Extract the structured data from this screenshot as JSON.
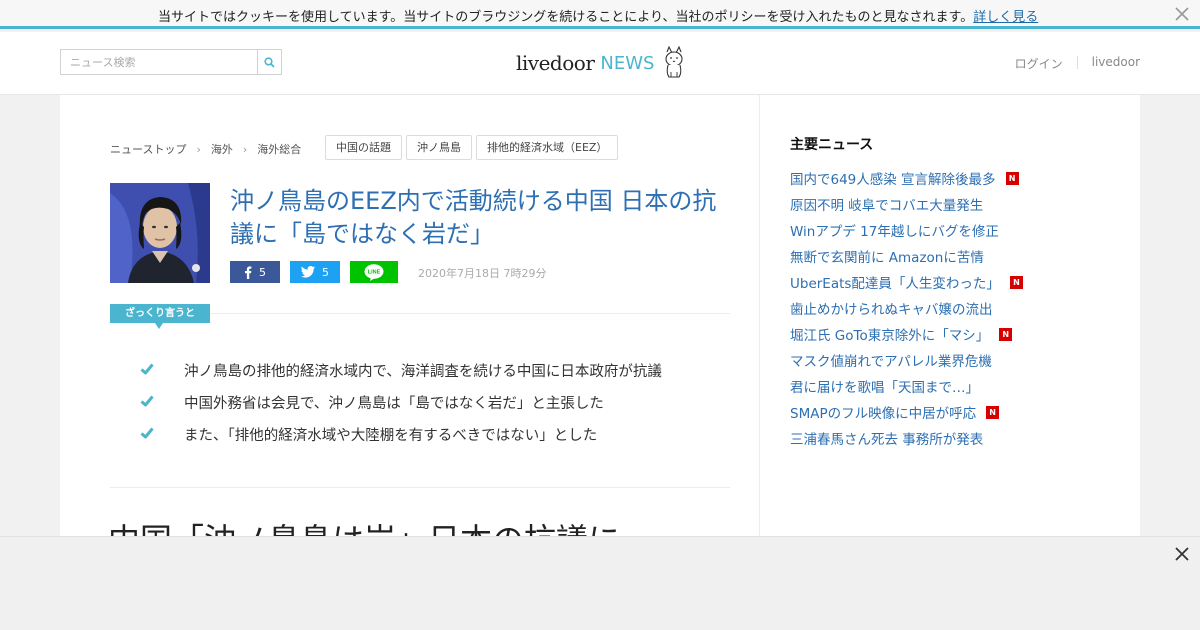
{
  "cookie_bar": {
    "text": "当サイトではクッキーを使用しています。当サイトのブラウジングを続けることにより、当社のポリシーを受け入れたものと見なされます。",
    "link": "詳しく見る",
    "close_icon": "close-icon"
  },
  "header": {
    "search_placeholder": "ニュース検索",
    "search_icon": "search-icon",
    "logo_livedoor": "livedoor",
    "logo_news": "NEWS",
    "logo_mark": "dog-mascot-icon",
    "login_link": "ログイン",
    "livedoor_link": "livedoor"
  },
  "breadcrumb": [
    "ニューストップ",
    "海外",
    "海外総合"
  ],
  "tags": [
    "中国の話題",
    "沖ノ鳥島",
    "排他的経済水域（EEZ）"
  ],
  "article": {
    "headline": "沖ノ鳥島のEEZ内で活動続ける中国 日本の抗議に「島ではなく岩だ」",
    "facebook_count": "5",
    "twitter_count": "5",
    "line_label": "LINE",
    "date": "2020年7月18日 7時29分",
    "summary_badge": "ざっくり言うと",
    "summary": [
      "沖ノ鳥島の排他的経済水域内で、海洋調査を続ける中国に日本政府が抗議",
      "中国外務省は会見で、沖ノ鳥島は「島ではなく岩だ」と主張した",
      "また、「排他的経済水域や大陸棚を有するべきではない」とした"
    ],
    "body_title": "中国「沖ノ鳥島は岩」日本の抗議に"
  },
  "sidebar": {
    "title": "主要ニュース",
    "new_badge": "N",
    "items": [
      {
        "label": "国内で649人感染 宣言解除後最多",
        "is_new": true
      },
      {
        "label": "原因不明 岐阜でコバエ大量発生",
        "is_new": false
      },
      {
        "label": "Winアプデ 17年越しにバグを修正",
        "is_new": false
      },
      {
        "label": "無断で玄関前に Amazonに苦情",
        "is_new": false
      },
      {
        "label": "UberEats配達員「人生変わった」",
        "is_new": true
      },
      {
        "label": "歯止めかけられぬキャバ嬢の流出",
        "is_new": false
      },
      {
        "label": "堀江氏 GoTo東京除外に「マシ」",
        "is_new": true
      },
      {
        "label": "マスク値崩れでアパレル業界危機",
        "is_new": false
      },
      {
        "label": "君に届けを歌唱「天国まで…」",
        "is_new": false
      },
      {
        "label": "SMAPのフル映像に中居が呼応",
        "is_new": true
      },
      {
        "label": "三浦春馬さん死去 事務所が発表",
        "is_new": false
      }
    ]
  },
  "colors": {
    "accent": "#4bb5cf",
    "link": "#2d6fb2",
    "facebook": "#3b5998",
    "twitter": "#1da1f2",
    "line": "#00c300",
    "new_badge": "#d50000"
  }
}
